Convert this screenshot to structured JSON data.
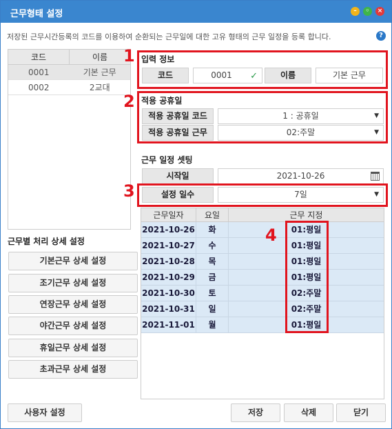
{
  "window": {
    "title": "근무형태 설정"
  },
  "description": "저장된 근무시간등록의 코드를 이용하여 순환되는 근무일에 대한 고유 형태의 근무 일정을 등록 합니다.",
  "code_list": {
    "headers": [
      "코드",
      "이름"
    ],
    "rows": [
      {
        "code": "0001",
        "name": "기본 근무"
      },
      {
        "code": "0002",
        "name": "2교대"
      }
    ]
  },
  "input_info": {
    "title": "입력 정보",
    "code_label": "코드",
    "code_value": "0001",
    "name_label": "이름",
    "name_value": "기본 근무"
  },
  "holiday": {
    "title": "적용 공휴일",
    "code_label": "적용 공휴일 코드",
    "code_value": "1 : 공휴일",
    "work_label": "적용 공휴일 근무",
    "work_value": "02:주말"
  },
  "schedule": {
    "title": "근무 일정 셋팅",
    "start_label": "시작일",
    "start_value": "2021-10-26",
    "days_label": "설정 일수",
    "days_value": "7일"
  },
  "grid": {
    "headers": [
      "근무일자",
      "요일",
      "근무 지정"
    ],
    "rows": [
      {
        "date": "2021-10-26",
        "day": "화",
        "work": "01:평일"
      },
      {
        "date": "2021-10-27",
        "day": "수",
        "work": "01:평일"
      },
      {
        "date": "2021-10-28",
        "day": "목",
        "work": "01:평일"
      },
      {
        "date": "2021-10-29",
        "day": "금",
        "work": "01:평일"
      },
      {
        "date": "2021-10-30",
        "day": "토",
        "work": "02:주말"
      },
      {
        "date": "2021-10-31",
        "day": "일",
        "work": "02:주말"
      },
      {
        "date": "2021-11-01",
        "day": "월",
        "work": "01:평일"
      }
    ]
  },
  "detail": {
    "title": "근무별 처리 상세 설정",
    "buttons": [
      "기본근무 상세 설정",
      "조기근무 상세 설정",
      "연장근무 상세 설정",
      "야간근무 상세 설정",
      "휴일근무 상세 설정",
      "초과근무 상세 설정"
    ]
  },
  "bottom": {
    "user_settings": "사용자 설정",
    "save": "저장",
    "delete": "삭제",
    "close": "닫기"
  },
  "annotations": [
    "1",
    "2",
    "3",
    "4"
  ],
  "colors": {
    "titlebar": "#3a86cf",
    "annotation": "#e1141e",
    "grid_row": "#dbe9f6"
  }
}
